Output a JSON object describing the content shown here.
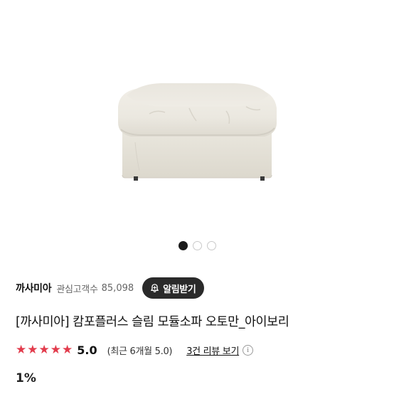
{
  "product_image": {
    "alt": "",
    "carousel": {
      "count": 3,
      "active_index": 0
    }
  },
  "seller": {
    "name": "까사미아",
    "followers_label": "관심고객수",
    "followers_count": "85,098",
    "alert_button": "알림받기",
    "alert_icon": "bell-plus-icon"
  },
  "product": {
    "title": "[까사미아] 캄포플러스 슬림 모듈소파 오토만_아이보리"
  },
  "rating": {
    "stars": 5,
    "score": "5.0",
    "recent": "(최근 6개월 5.0)",
    "review_link": "3건 리뷰 보기",
    "info_icon": "info-icon",
    "star_color": "#e23b4c"
  },
  "price": {
    "discount": "1%"
  }
}
